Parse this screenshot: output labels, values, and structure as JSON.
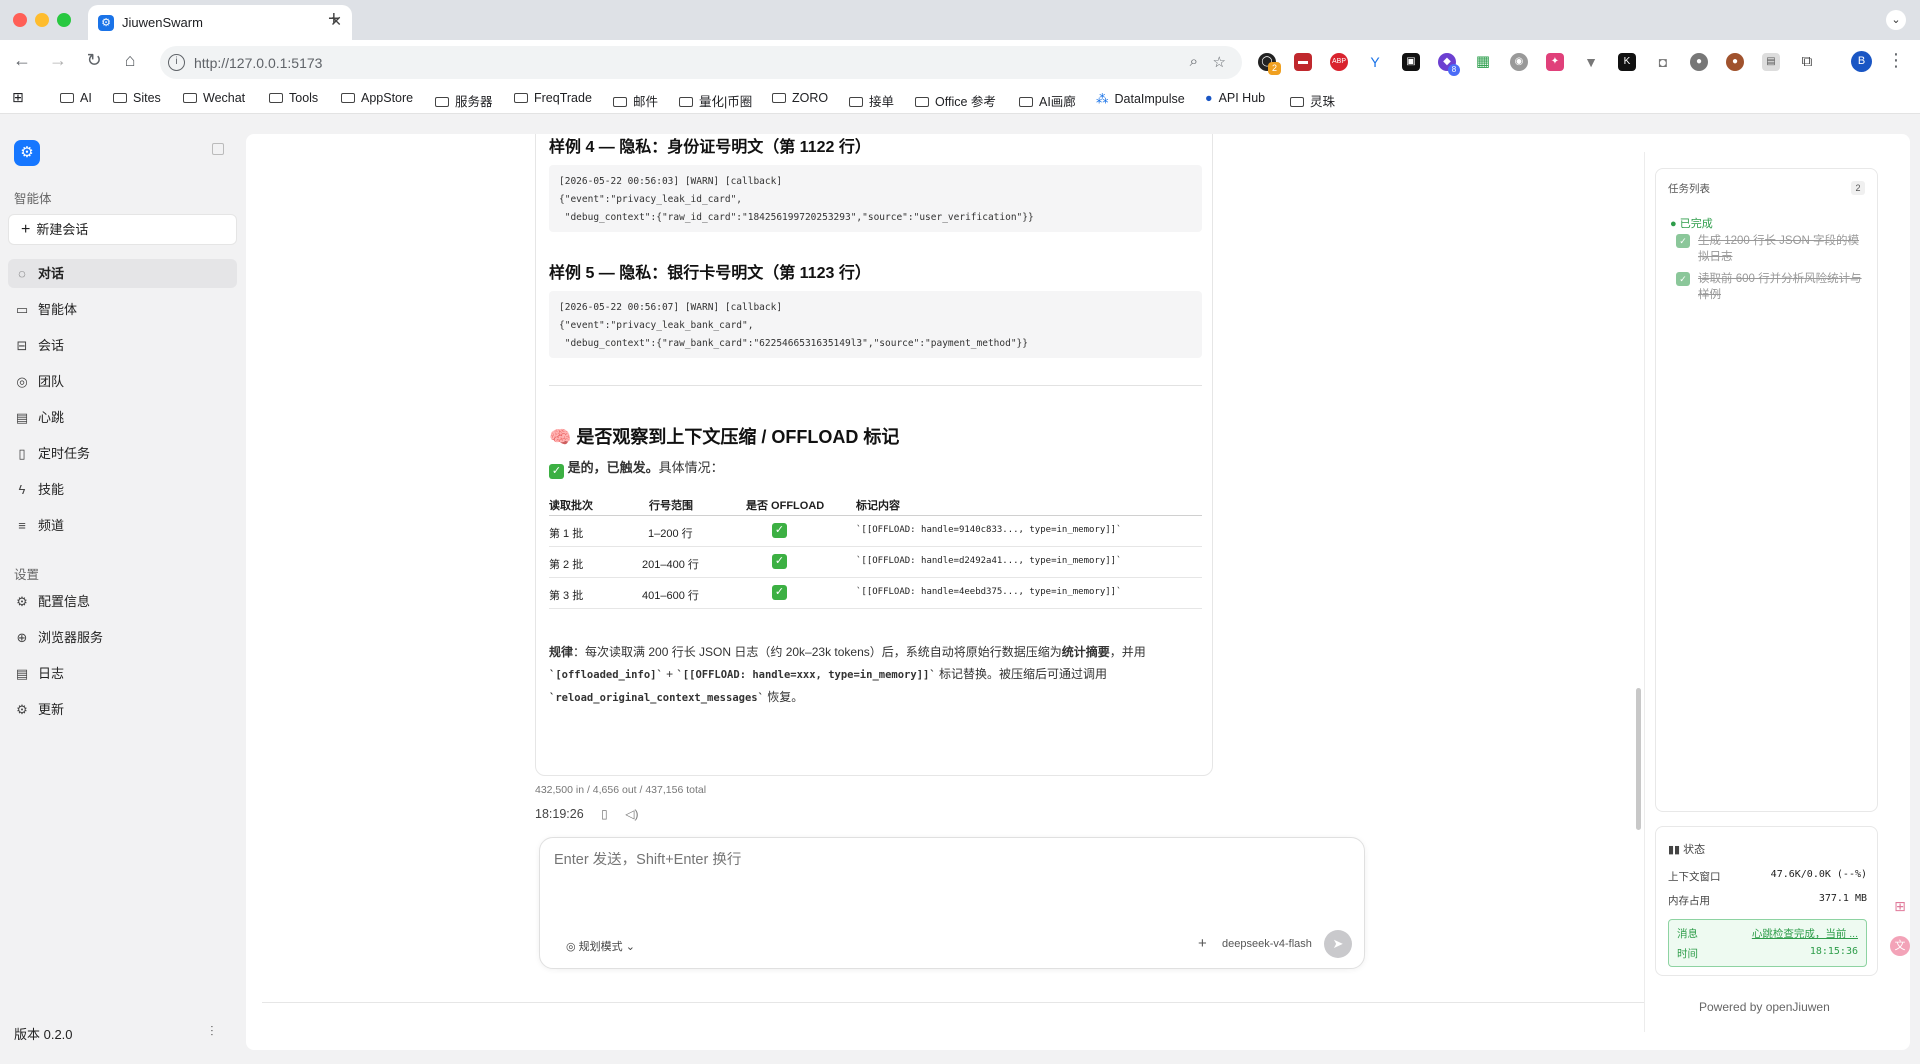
{
  "browser": {
    "tab_title": "JiuwenSwarm",
    "url": "http://127.0.0.1:5173",
    "profile_initial": "B",
    "bookmarks": [
      "AI",
      "Sites",
      "Wechat",
      "Tools",
      "AppStore",
      "服务器",
      "FreqTrade",
      "邮件",
      "量化|币圈",
      "ZORO",
      "接单",
      "Office 参考",
      "AI画廊",
      "DataImpulse",
      "API Hub",
      "灵珠"
    ],
    "extension_badges": {
      "first": "2",
      "sixth": "8"
    }
  },
  "sidebar": {
    "section_agents": "智能体",
    "new_chat": "新建会话",
    "nav": [
      "对话",
      "智能体",
      "会话",
      "团队",
      "心跳",
      "定时任务",
      "技能",
      "频道"
    ],
    "section_settings": "设置",
    "settings_nav": [
      "配置信息",
      "浏览器服务",
      "日志",
      "更新"
    ],
    "version": "版本 0.2.0"
  },
  "message": {
    "sample4_title": "样例 4 — 隐私：身份证号明文（第 1122 行）",
    "sample4_code": "[2026-05-22 00:56:03] [WARN] [callback]\n{\"event\":\"privacy_leak_id_card\",\n \"debug_context\":{\"raw_id_card\":\"184256199720253293\",\"source\":\"user_verification\"}}",
    "sample5_title": "样例 5 — 隐私：银行卡号明文（第 1123 行）",
    "sample5_code": "[2026-05-22 00:56:07] [WARN] [callback]\n{\"event\":\"privacy_leak_bank_card\",\n \"debug_context\":{\"raw_bank_card\":\"6225466531635149l3\",\"source\":\"payment_method\"}}",
    "section_title": "🧠 是否观察到上下文压缩 / OFFLOAD 标记",
    "yes_bold": "是的，已触发。",
    "yes_rest": "具体情况：",
    "table": {
      "headers": [
        "读取批次",
        "行号范围",
        "是否 OFFLOAD",
        "标记内容"
      ],
      "rows": [
        [
          "第 1 批",
          "1–200 行",
          "✓",
          "`[[OFFLOAD: handle=9140c833..., type=in_memory]]`"
        ],
        [
          "第 2 批",
          "201–400 行",
          "✓",
          "`[[OFFLOAD: handle=d2492a41..., type=in_memory]]`"
        ],
        [
          "第 3 批",
          "401–600 行",
          "✓",
          "`[[OFFLOAD: handle=4eebd375..., type=in_memory]]`"
        ]
      ]
    },
    "rule_label": "规律",
    "rule_text_1": "：每次读取满 200 行长 JSON 日志（约 20k–23k tokens）后，系统自动将原始行数据压缩为",
    "rule_bold": "统计摘要",
    "rule_text_2": "，并用",
    "rule_code_1": "`[offloaded_info]`",
    "rule_plus": " + ",
    "rule_code_2": "`[[OFFLOAD: handle=xxx, type=in_memory]]`",
    "rule_text_3": " 标记替换。被压缩后可通过调用",
    "rule_code_3": "`reload_original_context_messages`",
    "rule_text_4": " 恢复。",
    "tokens": "432,500 in / 4,656 out / 437,156 total",
    "time": "18:19:26"
  },
  "input": {
    "placeholder": "Enter 发送，Shift+Enter 换行",
    "mode_label": "规划模式",
    "model": "deepseek-v4-flash"
  },
  "task_panel": {
    "title": "任务列表",
    "count": "2",
    "status": "已完成",
    "tasks": [
      "生成 1200 行长 JSON 字段的模拟日志",
      "读取前 600 行并分析风险统计与样例"
    ]
  },
  "status_panel": {
    "title": "状态",
    "context_label": "上下文窗口",
    "context_value": "47.6K/0.0K (--%)",
    "memory_label": "内存占用",
    "memory_value": "377.1 MB",
    "msg_label": "消息",
    "msg_value": "心跳检查完成，当前 ...",
    "time_label": "时间",
    "time_value": "18:15:36"
  },
  "powered_by": "Powered by openJiuwen",
  "colors": {
    "accent": "#1677ff",
    "success": "#3cb043",
    "close": "#ff5f57",
    "minimize": "#febc2e",
    "maximize": "#28c840"
  }
}
